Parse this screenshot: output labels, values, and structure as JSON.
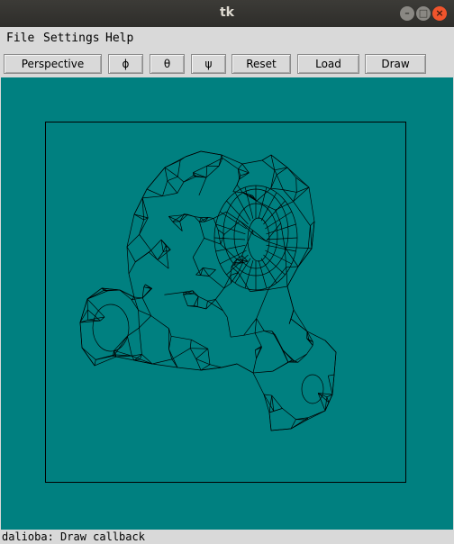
{
  "window": {
    "title": "tk"
  },
  "menubar": {
    "items": [
      "File",
      "Settings",
      "Help"
    ]
  },
  "toolbar": {
    "buttons": [
      "Perspective",
      "ϕ",
      "θ",
      "ψ",
      "Reset",
      "Load",
      "Draw"
    ]
  },
  "canvas": {
    "background": "#008080",
    "line_color": "#000000"
  },
  "status": {
    "text": "dalioba: Draw callback"
  }
}
